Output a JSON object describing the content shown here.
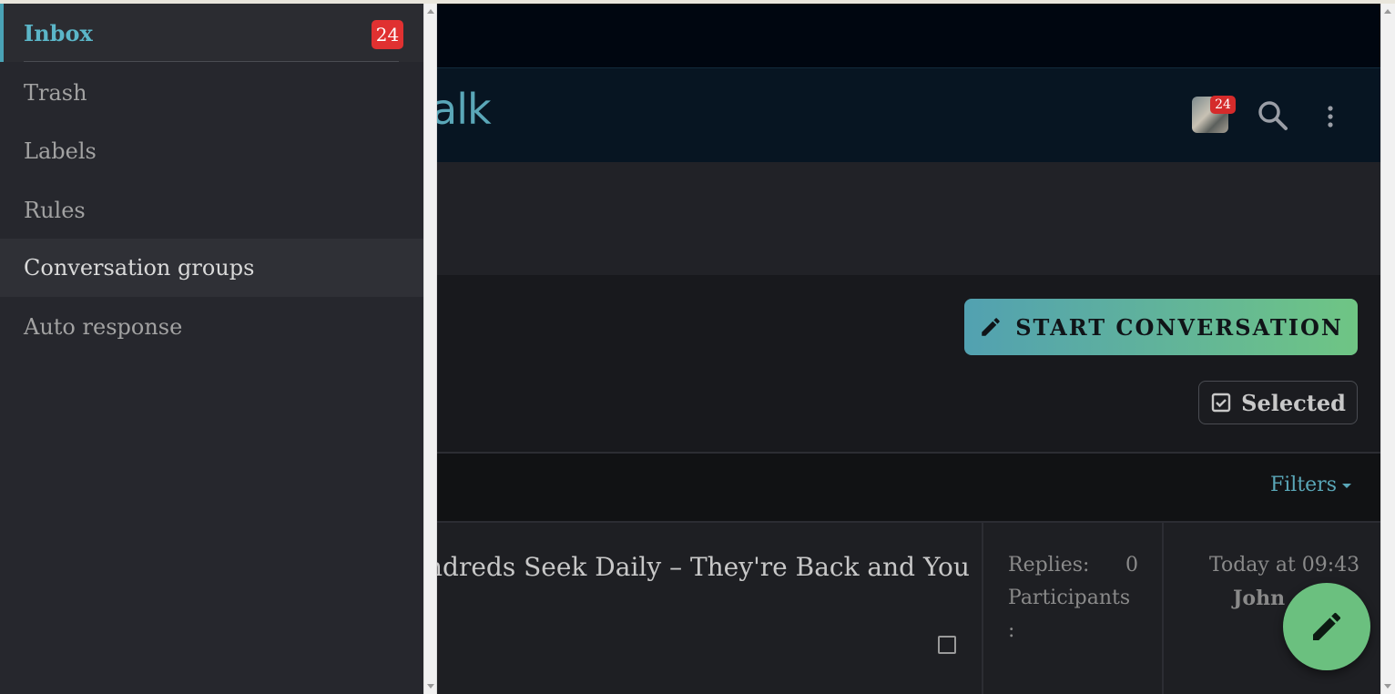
{
  "sidebar": {
    "items": [
      {
        "label": "Inbox",
        "badge": "24",
        "active": true
      },
      {
        "label": "Trash"
      },
      {
        "label": "Labels"
      },
      {
        "label": "Rules"
      },
      {
        "label": "Conversation groups",
        "hovered": true
      },
      {
        "label": "Auto response"
      }
    ]
  },
  "header": {
    "logo_fragment": "alk",
    "avatar_badge": "24",
    "icons": [
      "avatar",
      "search-icon",
      "more-vertical-icon"
    ]
  },
  "main": {
    "start_button": {
      "icon": "pencil-icon",
      "label": "START CONVERSATION"
    },
    "selected_button": {
      "icon": "checkbox-icon",
      "label": "Selected"
    },
    "filters_label": "Filters"
  },
  "row": {
    "title": "ndreds Seek Daily – They're Back and You",
    "replies_label": "Replies:",
    "replies_value": "0",
    "participants_label": "Participants",
    "participants_colon": ":",
    "date": "Today at 09:43",
    "author": "John"
  },
  "fab": {
    "icon": "pencil-icon"
  },
  "colors": {
    "accent": "#5bb6c8",
    "badge": "#e03131",
    "button_gradient_start": "#52a1b1",
    "button_gradient_end": "#6fc584",
    "fab": "#6bc07f"
  }
}
